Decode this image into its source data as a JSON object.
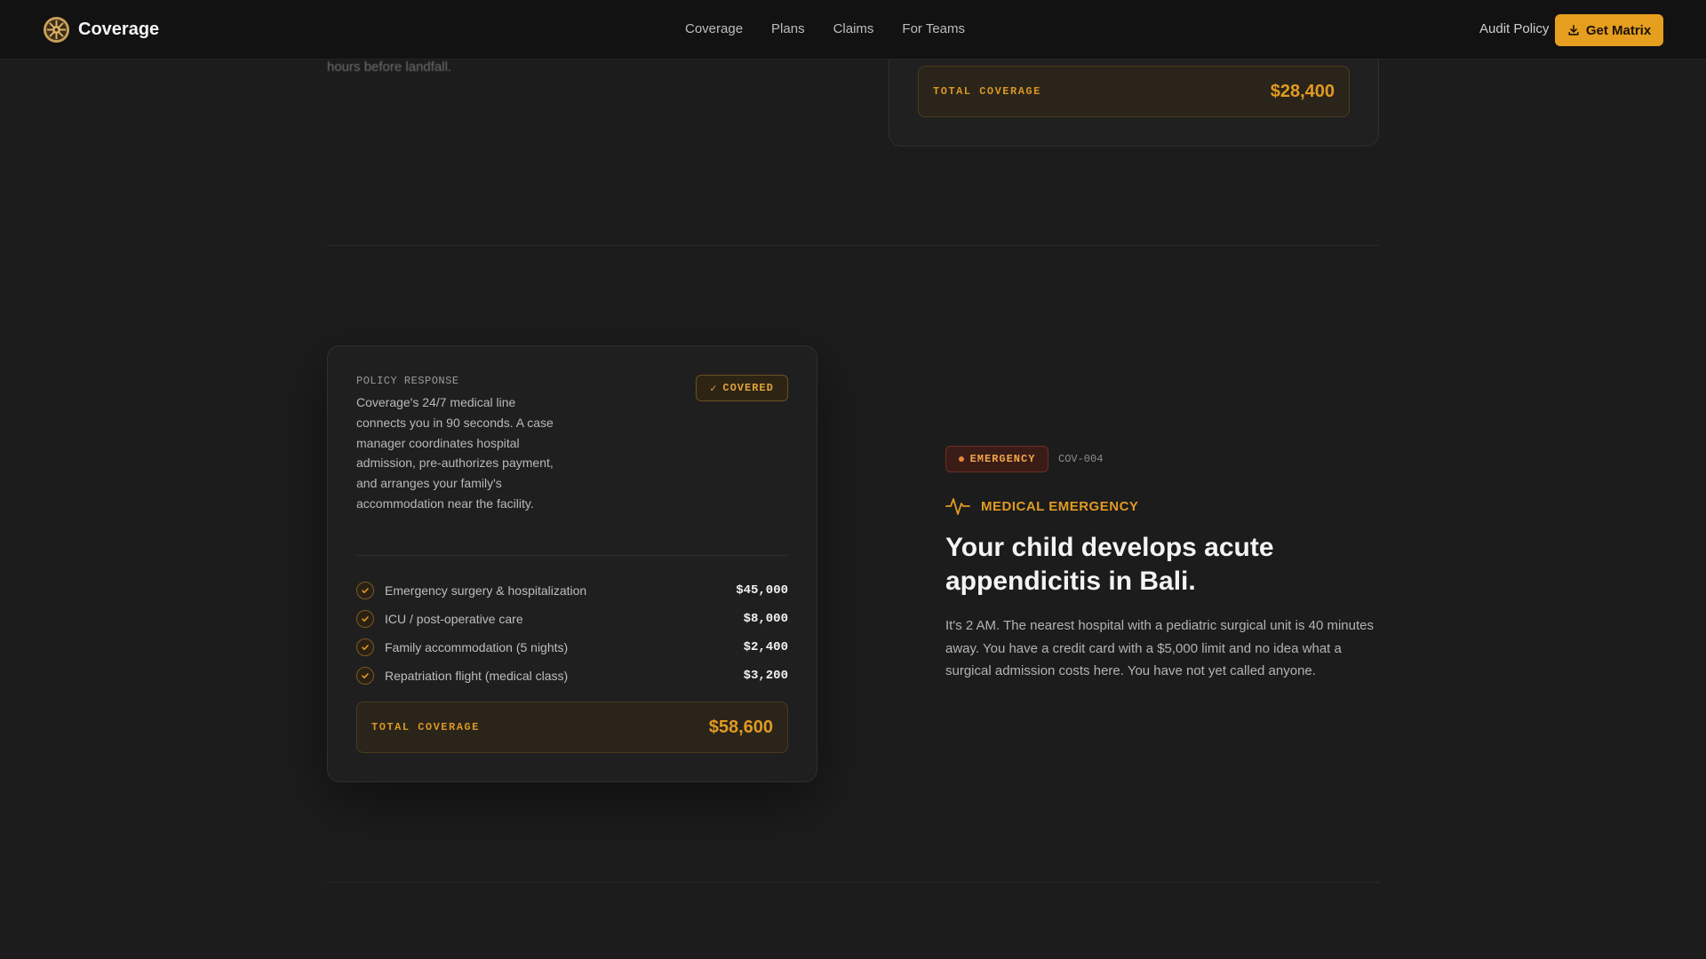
{
  "nav": {
    "brand": "Coverage",
    "links": [
      "Coverage",
      "Plans",
      "Claims",
      "For Teams"
    ],
    "audit": "Audit Policy",
    "cta": "Get Matrix"
  },
  "prev_section": {
    "faded_text": "hours before landfall.",
    "total_label": "TOTAL COVERAGE",
    "total_value": "$28,400"
  },
  "policy": {
    "label": "POLICY RESPONSE",
    "description": "Coverage's 24/7 medical line connects you in 90 seconds. A case manager coordinates hospital admission, pre-authorizes payment, and arranges your family's accommodation near the facility.",
    "badge": "COVERED",
    "items": [
      {
        "label": "Emergency surgery & hospitalization",
        "amount": "$45,000"
      },
      {
        "label": "ICU / post-operative care",
        "amount": "$8,000"
      },
      {
        "label": "Family accommodation (5 nights)",
        "amount": "$2,400"
      },
      {
        "label": "Repatriation flight (medical class)",
        "amount": "$3,200"
      }
    ],
    "total_label": "TOTAL COVERAGE",
    "total_value": "$58,600"
  },
  "scenario": {
    "tag": "EMERGENCY",
    "id": "COV-004",
    "category": "MEDICAL EMERGENCY",
    "headline": "Your child develops acute appendicitis in Bali.",
    "body": "It's 2 AM. The nearest hospital with a pediatric surgical unit is 40 minutes away. You have a credit card with a $5,000 limit and no idea what a surgical admission costs here. You have not yet called anyone."
  },
  "colors": {
    "accent": "#e59e1e",
    "background": "#1c1c1c",
    "emergency": "#e8873a"
  }
}
